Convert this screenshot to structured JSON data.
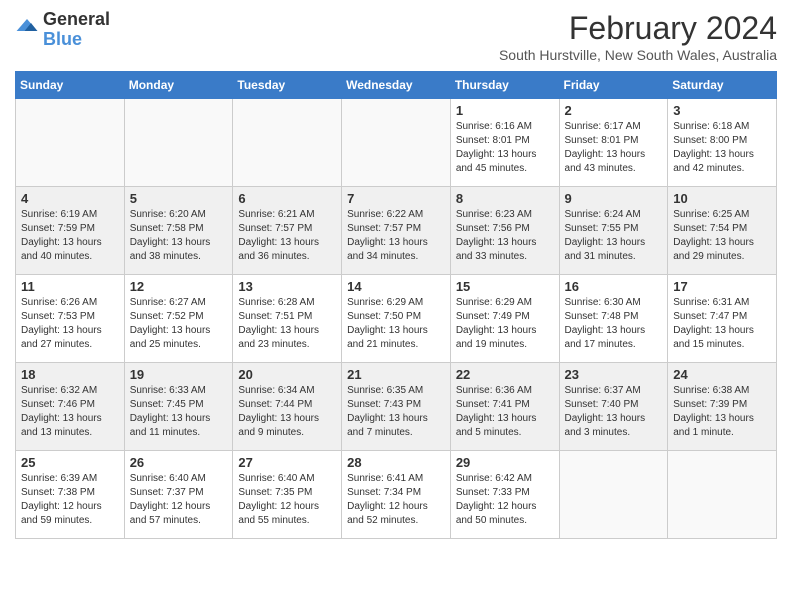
{
  "header": {
    "logo": {
      "text_general": "General",
      "text_blue": "Blue"
    },
    "title": "February 2024",
    "location": "South Hurstville, New South Wales, Australia"
  },
  "days_of_week": [
    "Sunday",
    "Monday",
    "Tuesday",
    "Wednesday",
    "Thursday",
    "Friday",
    "Saturday"
  ],
  "weeks": [
    [
      {
        "day": "",
        "info": ""
      },
      {
        "day": "",
        "info": ""
      },
      {
        "day": "",
        "info": ""
      },
      {
        "day": "",
        "info": ""
      },
      {
        "day": "1",
        "info": "Sunrise: 6:16 AM\nSunset: 8:01 PM\nDaylight: 13 hours\nand 45 minutes."
      },
      {
        "day": "2",
        "info": "Sunrise: 6:17 AM\nSunset: 8:01 PM\nDaylight: 13 hours\nand 43 minutes."
      },
      {
        "day": "3",
        "info": "Sunrise: 6:18 AM\nSunset: 8:00 PM\nDaylight: 13 hours\nand 42 minutes."
      }
    ],
    [
      {
        "day": "4",
        "info": "Sunrise: 6:19 AM\nSunset: 7:59 PM\nDaylight: 13 hours\nand 40 minutes."
      },
      {
        "day": "5",
        "info": "Sunrise: 6:20 AM\nSunset: 7:58 PM\nDaylight: 13 hours\nand 38 minutes."
      },
      {
        "day": "6",
        "info": "Sunrise: 6:21 AM\nSunset: 7:57 PM\nDaylight: 13 hours\nand 36 minutes."
      },
      {
        "day": "7",
        "info": "Sunrise: 6:22 AM\nSunset: 7:57 PM\nDaylight: 13 hours\nand 34 minutes."
      },
      {
        "day": "8",
        "info": "Sunrise: 6:23 AM\nSunset: 7:56 PM\nDaylight: 13 hours\nand 33 minutes."
      },
      {
        "day": "9",
        "info": "Sunrise: 6:24 AM\nSunset: 7:55 PM\nDaylight: 13 hours\nand 31 minutes."
      },
      {
        "day": "10",
        "info": "Sunrise: 6:25 AM\nSunset: 7:54 PM\nDaylight: 13 hours\nand 29 minutes."
      }
    ],
    [
      {
        "day": "11",
        "info": "Sunrise: 6:26 AM\nSunset: 7:53 PM\nDaylight: 13 hours\nand 27 minutes."
      },
      {
        "day": "12",
        "info": "Sunrise: 6:27 AM\nSunset: 7:52 PM\nDaylight: 13 hours\nand 25 minutes."
      },
      {
        "day": "13",
        "info": "Sunrise: 6:28 AM\nSunset: 7:51 PM\nDaylight: 13 hours\nand 23 minutes."
      },
      {
        "day": "14",
        "info": "Sunrise: 6:29 AM\nSunset: 7:50 PM\nDaylight: 13 hours\nand 21 minutes."
      },
      {
        "day": "15",
        "info": "Sunrise: 6:29 AM\nSunset: 7:49 PM\nDaylight: 13 hours\nand 19 minutes."
      },
      {
        "day": "16",
        "info": "Sunrise: 6:30 AM\nSunset: 7:48 PM\nDaylight: 13 hours\nand 17 minutes."
      },
      {
        "day": "17",
        "info": "Sunrise: 6:31 AM\nSunset: 7:47 PM\nDaylight: 13 hours\nand 15 minutes."
      }
    ],
    [
      {
        "day": "18",
        "info": "Sunrise: 6:32 AM\nSunset: 7:46 PM\nDaylight: 13 hours\nand 13 minutes."
      },
      {
        "day": "19",
        "info": "Sunrise: 6:33 AM\nSunset: 7:45 PM\nDaylight: 13 hours\nand 11 minutes."
      },
      {
        "day": "20",
        "info": "Sunrise: 6:34 AM\nSunset: 7:44 PM\nDaylight: 13 hours\nand 9 minutes."
      },
      {
        "day": "21",
        "info": "Sunrise: 6:35 AM\nSunset: 7:43 PM\nDaylight: 13 hours\nand 7 minutes."
      },
      {
        "day": "22",
        "info": "Sunrise: 6:36 AM\nSunset: 7:41 PM\nDaylight: 13 hours\nand 5 minutes."
      },
      {
        "day": "23",
        "info": "Sunrise: 6:37 AM\nSunset: 7:40 PM\nDaylight: 13 hours\nand 3 minutes."
      },
      {
        "day": "24",
        "info": "Sunrise: 6:38 AM\nSunset: 7:39 PM\nDaylight: 13 hours\nand 1 minute."
      }
    ],
    [
      {
        "day": "25",
        "info": "Sunrise: 6:39 AM\nSunset: 7:38 PM\nDaylight: 12 hours\nand 59 minutes."
      },
      {
        "day": "26",
        "info": "Sunrise: 6:40 AM\nSunset: 7:37 PM\nDaylight: 12 hours\nand 57 minutes."
      },
      {
        "day": "27",
        "info": "Sunrise: 6:40 AM\nSunset: 7:35 PM\nDaylight: 12 hours\nand 55 minutes."
      },
      {
        "day": "28",
        "info": "Sunrise: 6:41 AM\nSunset: 7:34 PM\nDaylight: 12 hours\nand 52 minutes."
      },
      {
        "day": "29",
        "info": "Sunrise: 6:42 AM\nSunset: 7:33 PM\nDaylight: 12 hours\nand 50 minutes."
      },
      {
        "day": "",
        "info": ""
      },
      {
        "day": "",
        "info": ""
      }
    ]
  ]
}
